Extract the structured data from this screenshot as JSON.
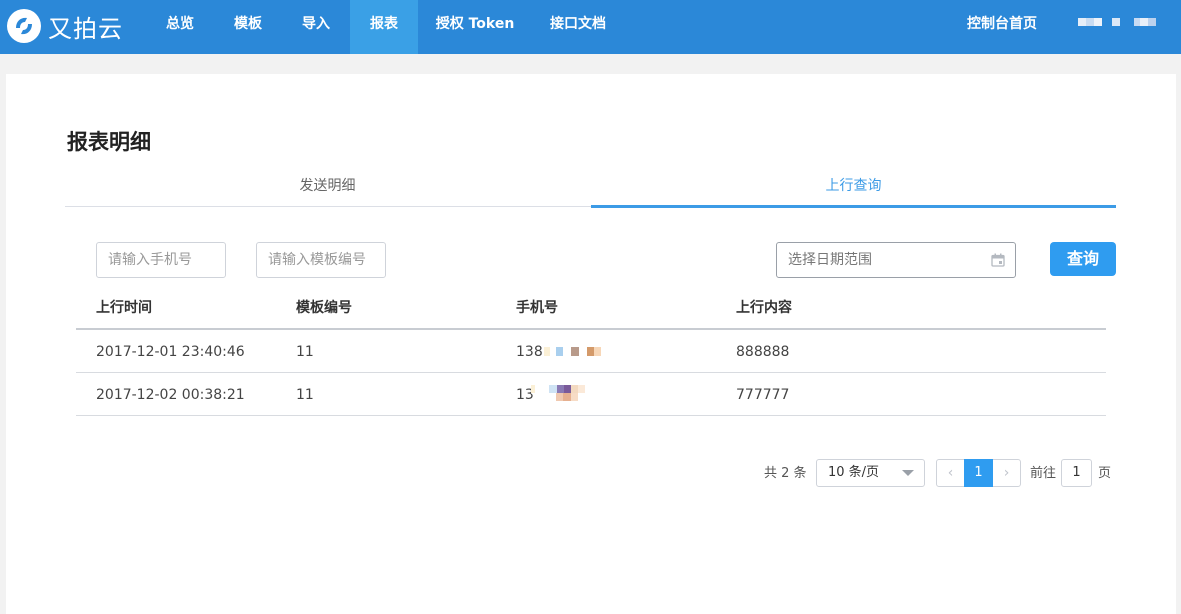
{
  "brand": {
    "name": "又拍云"
  },
  "nav": {
    "items": [
      {
        "label": "总览"
      },
      {
        "label": "模板"
      },
      {
        "label": "导入"
      },
      {
        "label": "报表"
      },
      {
        "label": "授权 Token"
      },
      {
        "label": "接口文档"
      }
    ],
    "active_index": 3,
    "console_home": "控制台首页"
  },
  "page": {
    "title": "报表明细",
    "tabs": [
      {
        "label": "发送明细"
      },
      {
        "label": "上行查询"
      }
    ],
    "active_tab": 1
  },
  "filters": {
    "phone_placeholder": "请输入手机号",
    "template_placeholder": "请输入模板编号",
    "date_placeholder": "选择日期范围",
    "search_label": "查询"
  },
  "table": {
    "columns": [
      "上行时间",
      "模板编号",
      "手机号",
      "上行内容"
    ],
    "rows": [
      {
        "time": "2017-12-01 23:40:46",
        "template": "11",
        "phone_prefix": "138",
        "content": "888888"
      },
      {
        "time": "2017-12-02 00:38:21",
        "template": "11",
        "phone_prefix": "13",
        "content": "777777"
      }
    ]
  },
  "pagination": {
    "total_text": "共 2 条",
    "page_size": "10 条/页",
    "current_page": "1",
    "goto_label": "前往",
    "goto_value": "1",
    "page_unit": "页"
  },
  "colors": {
    "topbar": "#2b88d8",
    "nav_active": "#3aa0e6",
    "accent": "#2f9cf0",
    "tab_active": "#3c9be6"
  }
}
